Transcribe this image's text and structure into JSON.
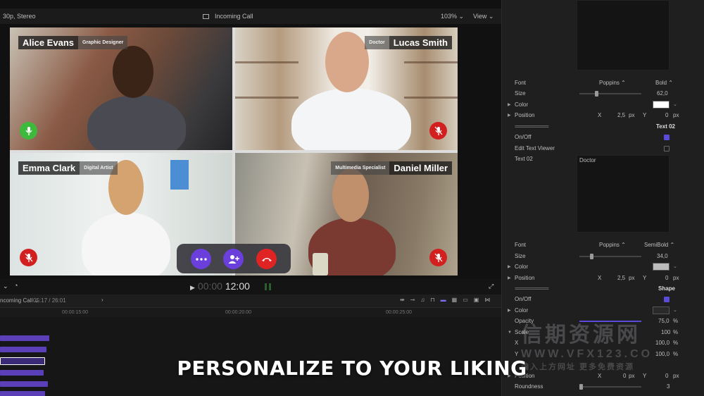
{
  "viewer": {
    "format": "30p, Stereo",
    "project_title": "Incoming Call",
    "zoom": "103%",
    "view_label": "View",
    "timecode_dim": "00:00",
    "timecode": "12:00"
  },
  "participants": [
    {
      "name": "Alice Evans",
      "role": "Graphic Designer",
      "mic": "on"
    },
    {
      "name": "Lucas Smith",
      "role": "Doctor",
      "mic": "off"
    },
    {
      "name": "Emma Clark",
      "role": "Digital Artist",
      "mic": "off"
    },
    {
      "name": "Daniel Miller",
      "role": "Multimedia Specialist",
      "mic": "off"
    }
  ],
  "timeline": {
    "project": "ncoming Call",
    "timecode": "05:17 / 26:01",
    "ruler": [
      "00:00:15:00",
      "00:00:20:00",
      "00:00:25:00"
    ]
  },
  "inspector": {
    "text01": {
      "font_label": "Font",
      "font": "Poppins",
      "weight": "Bold",
      "size_label": "Size",
      "size": "62,0",
      "size_level": 0.25,
      "color_label": "Color",
      "color": "#ffffff",
      "position_label": "Position",
      "x_label": "X",
      "x": "2,5",
      "y_label": "Y",
      "y": "0",
      "unit": "px"
    },
    "separator": "=============",
    "text02_header": "Text 02",
    "onoff_label": "On/Off",
    "edit_viewer_label": "Edit Text Viewer",
    "text02_label": "Text 02",
    "text02_value": "Doctor",
    "text02": {
      "font_label": "Font",
      "font": "Poppins",
      "weight": "SemiBold",
      "size_label": "Size",
      "size": "34,0",
      "size_level": 0.17,
      "color_label": "Color",
      "color": "#bcbcbc",
      "position_label": "Position",
      "x_label": "X",
      "x": "2,5",
      "y_label": "Y",
      "y": "0",
      "unit": "px"
    },
    "shape_header": "Shape",
    "shape": {
      "onoff_label": "On/Off",
      "color_label": "Color",
      "color": "#2a2a2a",
      "opacity_label": "Opacity",
      "opacity": "75,0",
      "opacity_unit": "%",
      "scale_label": "Scale",
      "scale": "100",
      "scale_unit": "%",
      "sx_label": "X",
      "sx": "100,0",
      "sy_label": "Y",
      "sy": "100,0",
      "position_label": "Position",
      "px_label": "X",
      "px": "0",
      "py_label": "Y",
      "py": "0",
      "unit": "px",
      "roundness_label": "Roundness",
      "roundness": "3"
    }
  },
  "caption": "PERSONALIZE TO YOUR LIKING",
  "watermark": {
    "line1": "信期资源网",
    "line2": "WWW.VFX123.CO",
    "line3": "输入上方网址 更多免费资源"
  }
}
